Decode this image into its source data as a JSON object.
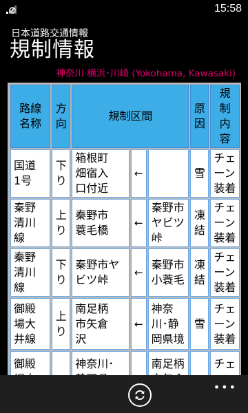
{
  "status": {
    "time": "15:58",
    "signal_icon": "signal-icon"
  },
  "header": {
    "app_title": "日本道路交通情報",
    "page_title": "規制情報",
    "region": "神奈川 横浜･川崎 (Yokohama, Kawasaki)",
    "region_color": "#e0006e"
  },
  "table": {
    "headers": {
      "route": "路線\n名称",
      "direction": "方\n向",
      "section": "規制区間",
      "cause": "原\n因",
      "detail": "規\n制\n内\n容"
    },
    "rows": [
      {
        "route": "国道\n1号",
        "direction": "下\nり",
        "from": "箱根町\n畑宿入\n口付近",
        "arrow": "←",
        "to": "",
        "cause": "雪",
        "detail": "チェ\nーン\n装着"
      },
      {
        "route": "秦野\n清川\n線",
        "direction": "上\nり",
        "from": "秦野市\n蓑毛橋",
        "arrow": "←",
        "to": "秦野市\nヤビツ峠",
        "cause": "凍\n結",
        "detail": "チェ\nーン\n装着"
      },
      {
        "route": "秦野\n清川\n線",
        "direction": "下\nり",
        "from": "秦野市ヤ\nビツ峠",
        "arrow": "←",
        "to": "秦野市\n小蓑毛",
        "cause": "凍\n結",
        "detail": "チェ\nーン\n装着"
      },
      {
        "route": "御殿\n場大\n井線",
        "direction": "上\nり",
        "from": "南足柄\n市矢倉\n沢",
        "arrow": "←",
        "to": "神奈\n川･静\n岡県境",
        "cause": "雪",
        "detail": "チェ\nーン\n装着"
      },
      {
        "route": "御殿\n場大",
        "direction": "",
        "from": "神奈川･\n静岡県",
        "arrow": "",
        "to": "南足柄\n市矢倉",
        "cause": "",
        "detail": "チェ\nーン"
      }
    ]
  },
  "appbar": {
    "refresh_icon": "refresh-icon",
    "more_label": "•••"
  }
}
